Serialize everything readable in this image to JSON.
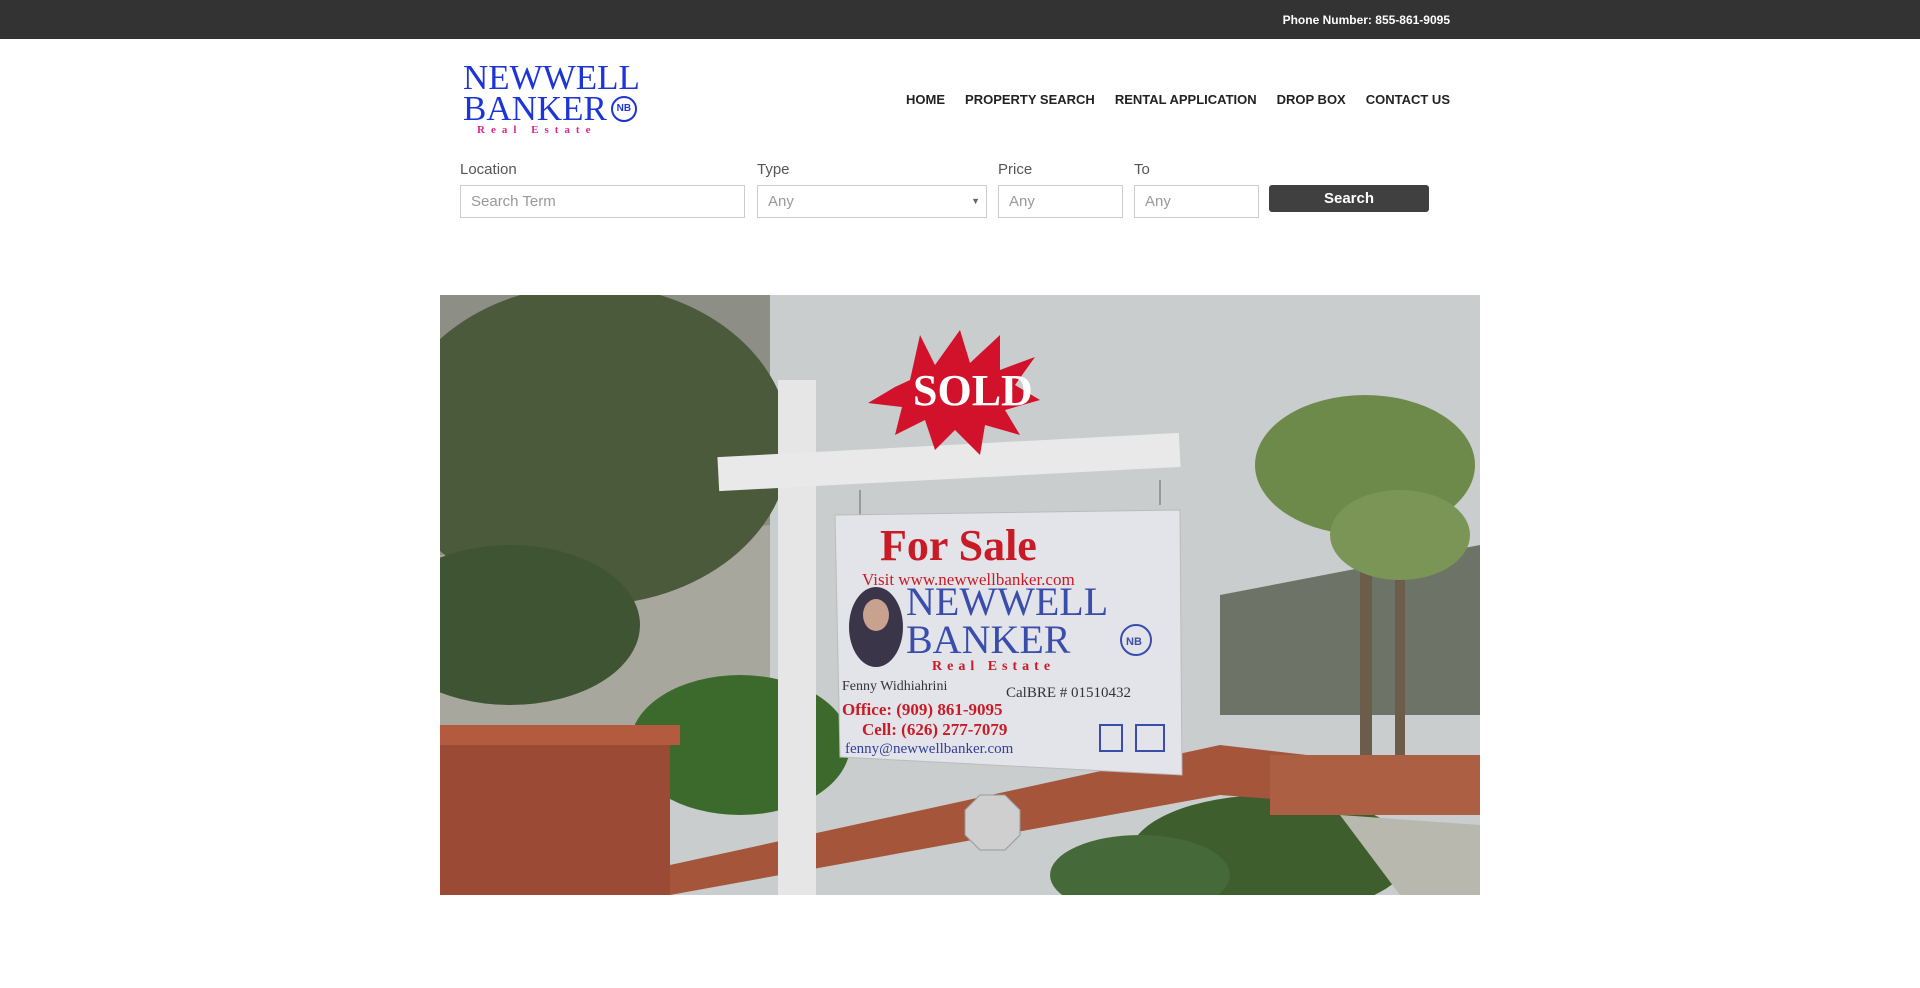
{
  "topbar": {
    "phone_text": "Phone Number: 855-861-9095"
  },
  "logo": {
    "line1": "NEWWELL",
    "line2": "BANKER",
    "badge": "NB",
    "tagline": "Real Estate"
  },
  "nav": {
    "items": [
      {
        "label": "HOME"
      },
      {
        "label": "PROPERTY SEARCH"
      },
      {
        "label": "RENTAL APPLICATION"
      },
      {
        "label": "DROP BOX"
      },
      {
        "label": "CONTACT US"
      }
    ]
  },
  "search": {
    "location_label": "Location",
    "location_placeholder": "Search Term",
    "type_label": "Type",
    "type_value": "Any",
    "price_label": "Price",
    "price_placeholder": "Any",
    "to_label": "To",
    "to_placeholder": "Any",
    "button_label": "Search"
  },
  "hero": {
    "sold_text": "SOLD",
    "sign_title": "For Sale",
    "sign_visit": "Visit www.newwellbanker.com",
    "sign_brand1": "NEWWELL",
    "sign_brand2": "BANKER",
    "sign_badge": "NB",
    "sign_tagline": "Real Estate",
    "agent_name": "Fenny Widhiahrini",
    "calbre": "CalBRE # 01510432",
    "office": "Office: (909) 861-9095",
    "cell": "Cell: (626) 277-7079",
    "email": "fenny@newwellbanker.com"
  }
}
